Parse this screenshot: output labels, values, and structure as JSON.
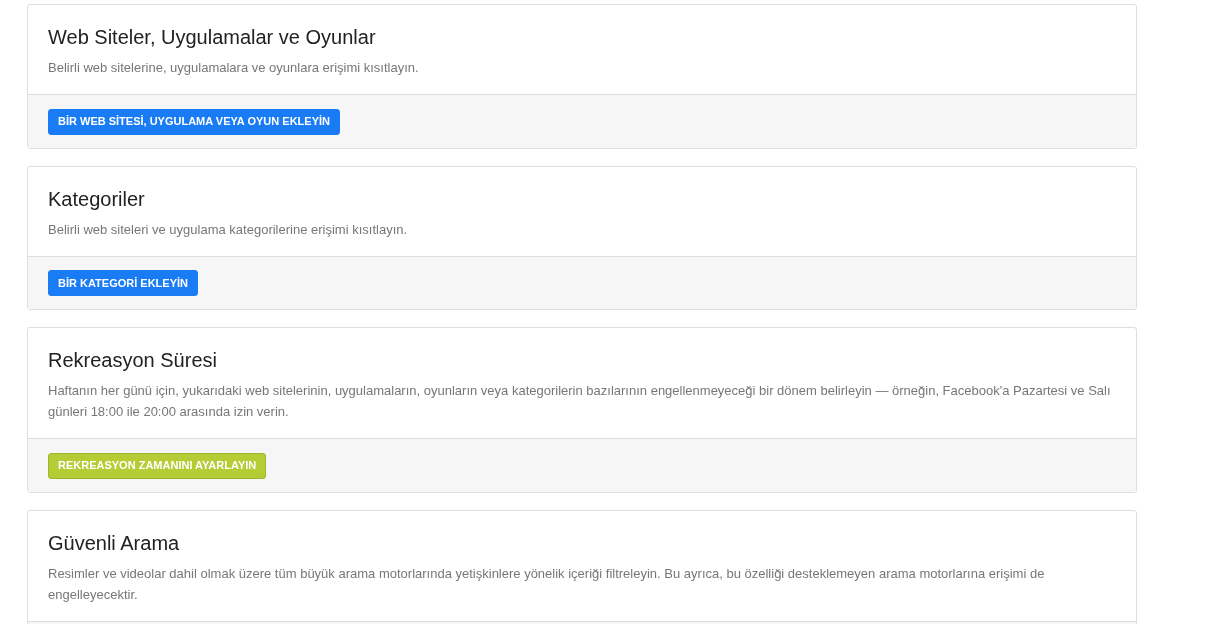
{
  "cards": [
    {
      "title": "Web Siteler, Uygulamalar ve Oyunlar",
      "description": "Belirli web sitelerine, uygulamalara ve oyunlara erişimi kısıtlayın.",
      "button": {
        "label": "BİR WEB SİTESİ, UYGULAMA VEYA OYUN EKLEYİN",
        "kind": "primary"
      }
    },
    {
      "title": "Kategoriler",
      "description": "Belirli web siteleri ve uygulama kategorilerine erişimi kısıtlayın.",
      "button": {
        "label": "BİR KATEGORİ EKLEYİN",
        "kind": "primary"
      }
    },
    {
      "title": "Rekreasyon Süresi",
      "description": "Haftanın her günü için, yukarıdaki web sitelerinin, uygulamaların, oyunların veya kategorilerin bazılarının engellenmeyeceği bir dönem belirleyin — örneğin, Facebook'a Pazartesi ve Salı günleri 18:00 ile 20:00 arasında izin verin.",
      "button": {
        "label": "REKREASYON ZAMANINI AYARLAYIN",
        "kind": "accent"
      }
    },
    {
      "title": "Güvenli Arama",
      "description": "Resimler ve videolar dahil olmak üzere tüm büyük arama motorlarında yetişkinlere yönelik içeriği filtreleyin. Bu ayrıca, bu özelliği desteklemeyen arama motorlarına erişimi de engelleyecektir."
    }
  ]
}
